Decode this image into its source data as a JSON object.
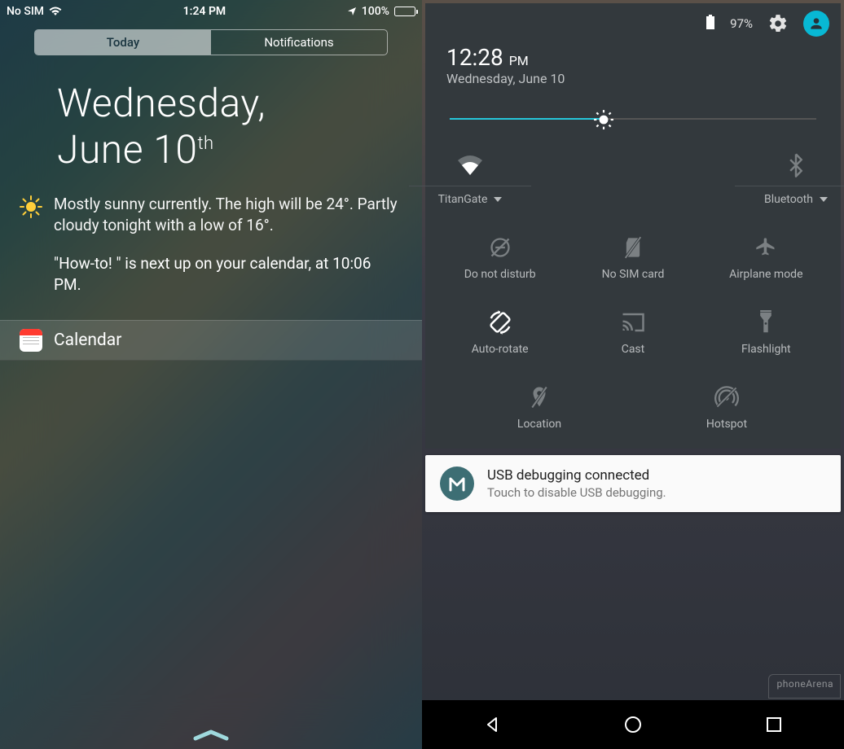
{
  "ios": {
    "status": {
      "carrier": "No SIM",
      "time": "1:24 PM",
      "battery_pct": "100%"
    },
    "tabs": {
      "today": "Today",
      "notifications": "Notifications"
    },
    "date": {
      "weekday": "Wednesday,",
      "month_day": "June 10",
      "ordinal": "th"
    },
    "weather": {
      "icon": "sun",
      "text": "Mostly sunny currently. The high will be 24°. Partly cloudy tonight with a low of 16°."
    },
    "next_event": "\"How-to! \" is next up on your calendar, at 10:06 PM.",
    "calendar_widget_label": "Calendar"
  },
  "android": {
    "status": {
      "battery_pct": "97%"
    },
    "time": {
      "clock": "12:28",
      "ampm": "PM",
      "date": "Wednesday, June 10"
    },
    "brightness": {
      "percent": 42
    },
    "quick_settings": {
      "wifi": {
        "label": "TitanGate",
        "expandable": true
      },
      "bluetooth": {
        "label": "Bluetooth",
        "expandable": true
      },
      "dnd": {
        "label": "Do not disturb"
      },
      "sim": {
        "label": "No SIM card"
      },
      "airplane": {
        "label": "Airplane mode"
      },
      "rotate": {
        "label": "Auto-rotate"
      },
      "cast": {
        "label": "Cast"
      },
      "flashlight": {
        "label": "Flashlight"
      },
      "location": {
        "label": "Location"
      },
      "hotspot": {
        "label": "Hotspot"
      }
    },
    "notification": {
      "title": "USB debugging connected",
      "subtitle": "Touch to disable USB debugging."
    }
  },
  "watermark": "phoneArena"
}
